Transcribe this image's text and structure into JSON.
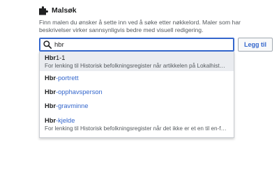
{
  "section": {
    "title": "Malsøk",
    "icon": "puzzle-icon",
    "description": "Finn malen du ønsker å sette inn ved å søke etter nøkkelord. Maler som har beskrivelser virker sannsynligvis bedre med visuell redigering."
  },
  "search": {
    "value": "hbr",
    "placeholder": "",
    "icon": "search-icon"
  },
  "add_button": {
    "label": "Legg til"
  },
  "suggestions": [
    {
      "match": "Hbr",
      "rest": "1-1",
      "description": "For lenking til Historisk befolkningsregister når artikkelen på Lokalhist…",
      "highlighted": true
    },
    {
      "match": "Hbr",
      "rest": "-portrett",
      "description": "",
      "highlighted": false
    },
    {
      "match": "Hbr",
      "rest": "-opphavsperson",
      "description": "",
      "highlighted": false
    },
    {
      "match": "Hbr",
      "rest": "-gravminne",
      "description": "",
      "highlighted": false
    },
    {
      "match": "Hbr",
      "rest": "-kjelde",
      "description": "For lenking til Historisk befolkningsregister når det ikke er et en til en-f…",
      "highlighted": false
    }
  ],
  "colors": {
    "accent": "#3366cc",
    "highlight_bg": "#eaecf0",
    "text": "#202122",
    "muted": "#54595d"
  }
}
